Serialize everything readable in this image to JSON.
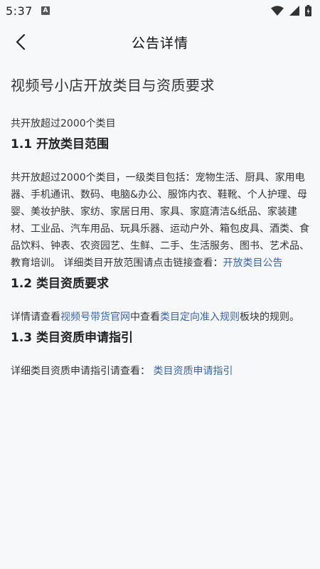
{
  "status": {
    "time": "5:37",
    "notice_badge": "A"
  },
  "nav": {
    "title": "公告详情"
  },
  "article": {
    "title": "视频号小店开放类目与资质要求",
    "intro": "共开放超过2000个类目",
    "section1": {
      "heading": "1.1 开放类目范围",
      "body": "共开放超过2000个类目，一级类目包括：宠物生活、厨具、家用电器、手机通讯、数码、电脑&办公、服饰内衣、鞋靴、个人护理、母婴、美妆护肤、家纺、家居日用、家具、家庭清洁&纸品、家装建材、工业品、汽车用品、玩具乐器、运动户外、箱包皮具、酒类、食品饮料、钟表、农资园艺、生鲜、二手、生活服务、图书、艺术品、教育培训。 详细类目开放范围请点击链接查看：",
      "link": "开放类目公告"
    },
    "section2": {
      "heading": "1.2 类目资质要求",
      "pre": "详情请查看",
      "link1": "视频号带货官网",
      "mid": "中查看",
      "link2": "类目定向准入规则",
      "post": "板块的规则。"
    },
    "section3": {
      "heading": "1.3 类目资质申请指引",
      "pre": "详细类目资质申请指引请查看： ",
      "link": "类目资质申请指引"
    }
  }
}
